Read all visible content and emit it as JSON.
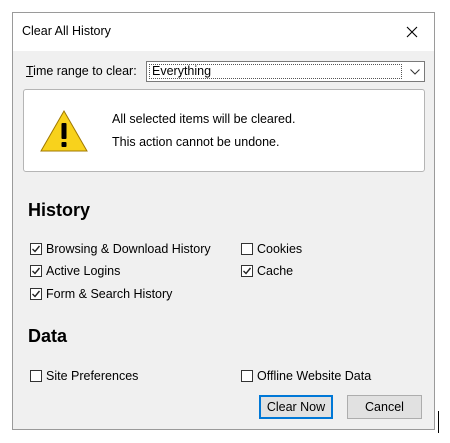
{
  "window": {
    "title": "Clear All History"
  },
  "time_range": {
    "label_accel": "T",
    "label_rest": "ime range to clear:",
    "selected": "Everything"
  },
  "warning": {
    "line1": "All selected items will be cleared.",
    "line2": "This action cannot be undone."
  },
  "history": {
    "heading": "History",
    "items": [
      {
        "label": "Browsing & Download History",
        "checked": true
      },
      {
        "label": "Cookies",
        "checked": false
      },
      {
        "label": "Active Logins",
        "checked": true
      },
      {
        "label": "Cache",
        "checked": true
      },
      {
        "label": "Form & Search History",
        "checked": true
      }
    ]
  },
  "data_section": {
    "heading": "Data",
    "items": [
      {
        "label": "Site Preferences",
        "checked": false
      },
      {
        "label": "Offline Website Data",
        "checked": false
      }
    ]
  },
  "buttons": {
    "clear_now": "Clear Now",
    "cancel": "Cancel"
  },
  "colors": {
    "dialog_bg": "#f0f0f0",
    "default_button_border": "#0078d7",
    "warning_yellow": "#f8d21c"
  },
  "icons": {
    "close": "close-icon",
    "dropdown": "chevron-down-icon",
    "warning": "warning-icon",
    "check": "checkmark-icon"
  }
}
